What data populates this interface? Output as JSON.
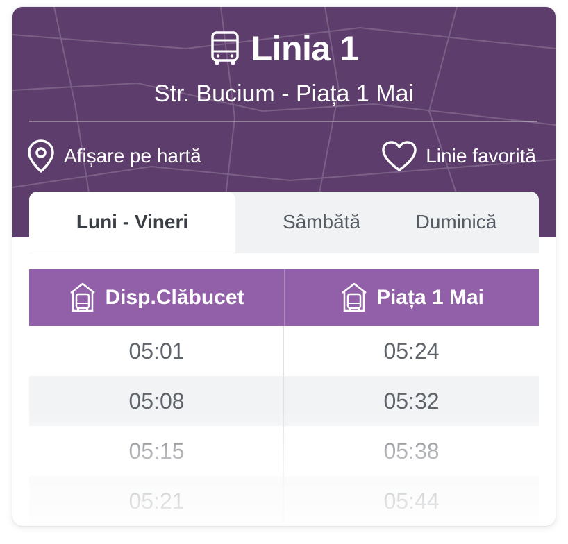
{
  "header": {
    "title": "Linia 1",
    "route": "Str. Bucium - Piața 1 Mai",
    "map_link_label": "Afișare pe hartă",
    "favorite_label": "Linie favorită",
    "title_icon": "bus-icon",
    "map_icon": "location-pin-icon",
    "favorite_icon": "heart-outline-icon"
  },
  "tabs": [
    {
      "label": "Luni - Vineri",
      "active": true
    },
    {
      "label": "Sâmbătă",
      "active": false
    },
    {
      "label": "Duminică",
      "active": false
    }
  ],
  "table": {
    "columns": [
      {
        "label": "Disp.Clăbucet",
        "icon": "bus-station-icon"
      },
      {
        "label": "Piața 1 Mai",
        "icon": "bus-station-icon"
      }
    ],
    "rows": [
      [
        "05:01",
        "05:24"
      ],
      [
        "05:08",
        "05:32"
      ],
      [
        "05:15",
        "05:38"
      ],
      [
        "05:21",
        "05:44"
      ]
    ]
  },
  "colors": {
    "header_bg": "#5d3d6b",
    "table_header_bg": "#9160a8",
    "tab_bar_bg": "#f1f2f4",
    "row_alt_bg": "#f2f3f5",
    "time_text": "#5f646b"
  }
}
